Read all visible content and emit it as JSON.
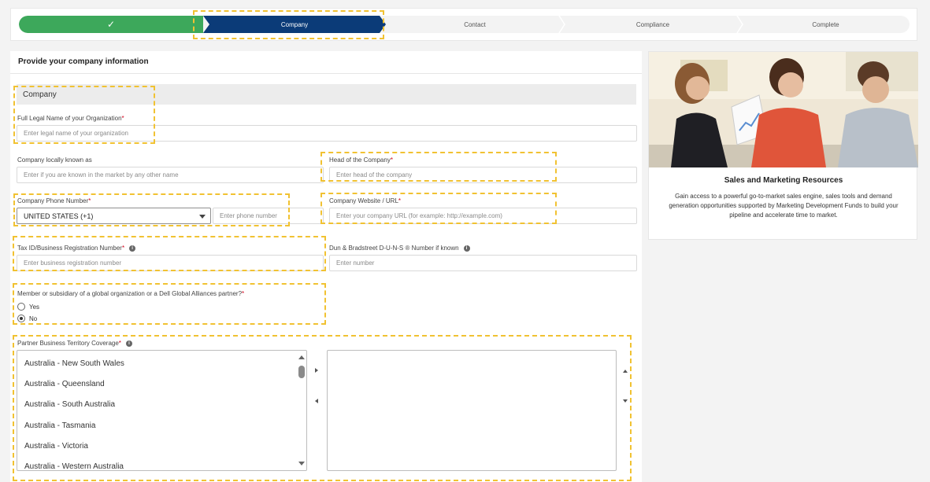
{
  "progress": {
    "steps": [
      {
        "label": "",
        "state": "done",
        "icon": "check-icon"
      },
      {
        "label": "Company",
        "state": "active"
      },
      {
        "label": "Contact",
        "state": "pending"
      },
      {
        "label": "Compliance",
        "state": "pending"
      },
      {
        "label": "Complete",
        "state": "pending"
      }
    ],
    "check_glyph": "✓"
  },
  "form": {
    "title": "Provide your company information",
    "section": "Company",
    "legal_name": {
      "label": "Full Legal Name of your Organization",
      "placeholder": "Enter legal name of your organization"
    },
    "local_name": {
      "label": "Company locally known as",
      "placeholder": "Enter if you are known in the market by any other name"
    },
    "head": {
      "label": "Head of the Company",
      "placeholder": "Enter head of the company"
    },
    "phone": {
      "label": "Company Phone Number",
      "country": "UNITED STATES (+1)",
      "placeholder": "Enter phone number"
    },
    "website": {
      "label": "Company Website / URL",
      "placeholder": "Enter your company URL (for example: http://example.com)"
    },
    "tax_id": {
      "label": "Tax ID/Business Registration Number",
      "placeholder": "Enter business registration number"
    },
    "duns": {
      "label": "Dun & Bradstreet D-U-N-S ® Number if known",
      "placeholder": "Enter number"
    },
    "member": {
      "label": "Member or subsidiary of a global organization or a Dell Global Alliances partner?",
      "options": [
        "Yes",
        "No"
      ],
      "selected": "No"
    },
    "territory": {
      "label": "Partner Business Territory Coverage",
      "available": [
        "Australia - New South Wales",
        "Australia - Queensland",
        "Australia - South Australia",
        "Australia - Tasmania",
        "Australia - Victoria",
        "Australia - Western Australia"
      ],
      "selected": []
    },
    "required_mark": "*",
    "info_glyph": "i"
  },
  "sidebar": {
    "title": "Sales and Marketing Resources",
    "body": "Gain access to a powerful go-to-market sales engine, sales tools and demand generation opportunities supported by Marketing Development Funds to build your pipeline and accelerate time to market."
  },
  "colors": {
    "done": "#3da85b",
    "active": "#0b3b78",
    "highlight": "#f1c232",
    "required": "#d0021b"
  }
}
